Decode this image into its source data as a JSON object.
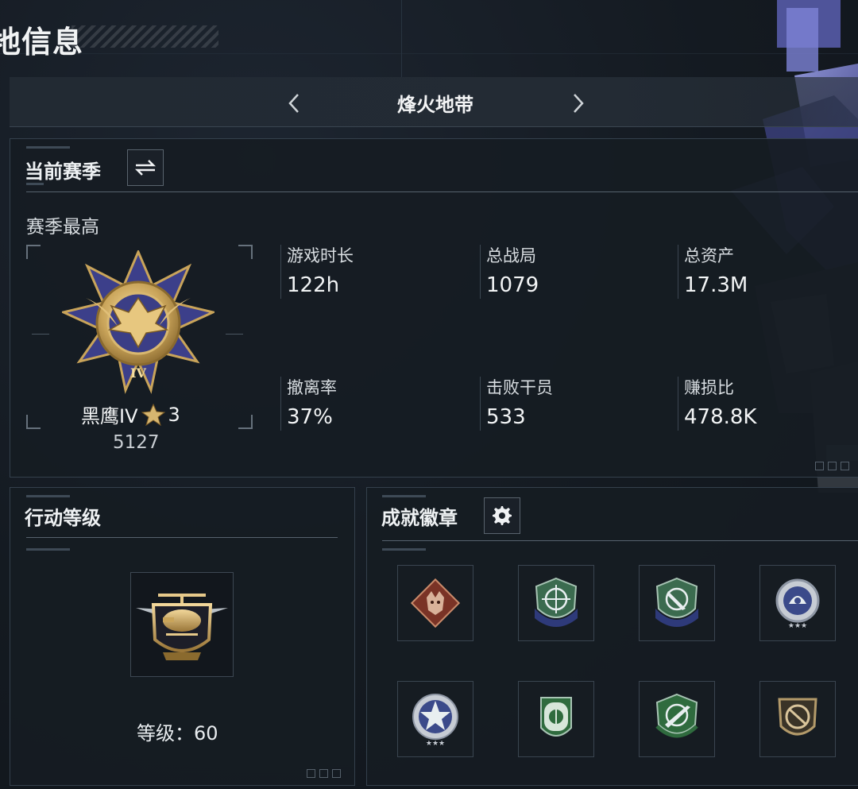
{
  "page": {
    "title": "地信息"
  },
  "mode": {
    "title": "烽火地带"
  },
  "season": {
    "title": "当前赛季",
    "best_label": "赛季最高",
    "rank_name": "黑鹰IV",
    "rank_stars": "3",
    "rank_score": "5127",
    "rank_numeral": "IV",
    "stats": [
      {
        "label": "游戏时长",
        "value": "122h"
      },
      {
        "label": "总战局",
        "value": "1079"
      },
      {
        "label": "总资产",
        "value": "17.3M"
      },
      {
        "label": "撤离率",
        "value": "37%"
      },
      {
        "label": "击败干员",
        "value": "533"
      },
      {
        "label": "赚损比",
        "value": "478.8K"
      }
    ]
  },
  "ops": {
    "title": "行动等级",
    "level_label": "等级：",
    "level_value": "60"
  },
  "achievements": {
    "title": "成就徽章",
    "badges": [
      {
        "icon": "wolf-badge-icon",
        "color": "#8a3b2c"
      },
      {
        "icon": "crosshair-shield-icon",
        "color": "#3b6b4f"
      },
      {
        "icon": "knife-shield-icon",
        "color": "#3b6b4f"
      },
      {
        "icon": "helmet-badge-icon",
        "color": "#3b4a8a"
      },
      {
        "icon": "star-badge-icon",
        "color": "#3b4a8a"
      },
      {
        "icon": "green-shield-icon",
        "color": "#2f6b3e"
      },
      {
        "icon": "rifle-shield-icon",
        "color": "#2f6b3e"
      },
      {
        "icon": "bronze-shield-icon",
        "color": "#6b5a3a"
      }
    ]
  },
  "colors": {
    "panel_border": "#34404c",
    "accent_gold": "#c9a45a",
    "accent_blue": "#3c3f8a"
  }
}
